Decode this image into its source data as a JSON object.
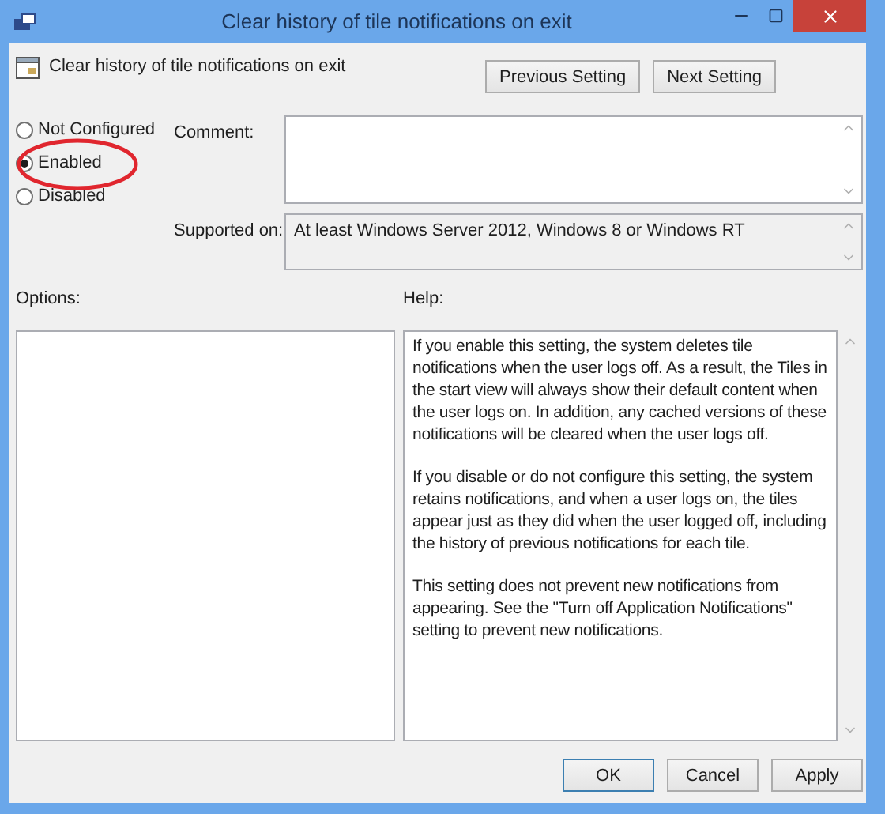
{
  "window": {
    "title": "Clear history of tile notifications on exit"
  },
  "header": {
    "policy_name": "Clear history of tile notifications on exit",
    "buttons": [
      "Previous Setting",
      "Next Setting"
    ]
  },
  "states": [
    {
      "label": "Not Configured",
      "selected": false,
      "highlighted": false
    },
    {
      "label": "Enabled",
      "selected": true,
      "highlighted": true
    },
    {
      "label": "Disabled",
      "selected": false,
      "highlighted": false
    }
  ],
  "comment": {
    "label": "Comment:"
  },
  "supported_on": {
    "label": "Supported on:",
    "value": "At least Windows Server 2012, Windows 8 or Windows RT"
  },
  "options": {
    "label": "Options:"
  },
  "help": {
    "label": "Help:",
    "paragraphs": [
      "If you enable this setting, the system deletes tile notifications when the user logs off. As a result, the Tiles in the start view will always show their default content when the user logs on. In addition, any cached versions of these notifications will be cleared when the user logs off.",
      "If you disable or do not configure this setting, the system retains notifications, and when a user logs on, the tiles appear just as they did when the user logged off, including the history of previous notifications for each tile.",
      "This setting does not prevent new notifications from appearing. See the \"Turn off Application Notifications\" setting to prevent new notifications."
    ]
  },
  "footer_buttons": [
    {
      "label": "OK",
      "default": true
    },
    {
      "label": "Cancel",
      "default": false
    },
    {
      "label": "Apply",
      "default": false
    }
  ]
}
